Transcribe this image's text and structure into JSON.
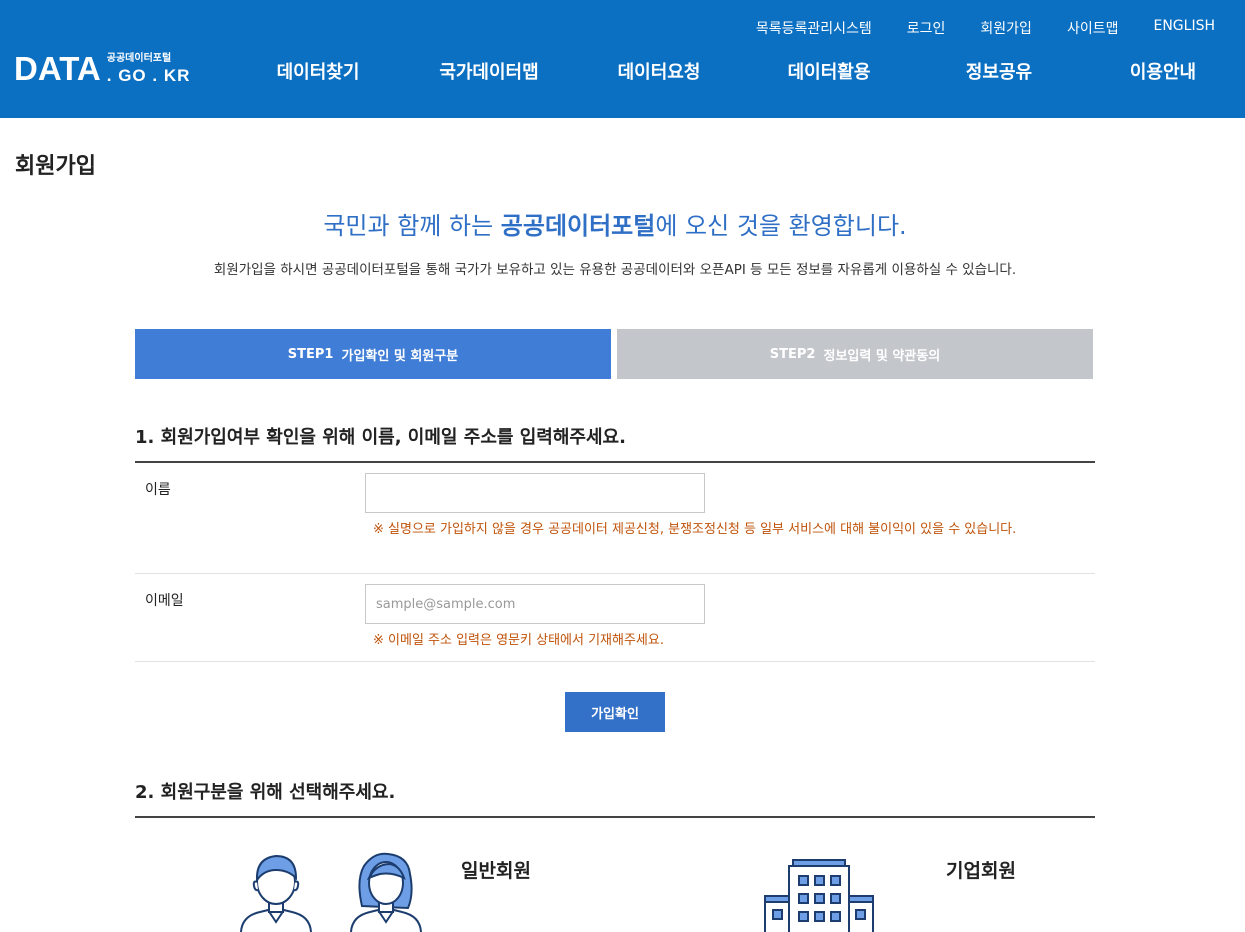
{
  "header": {
    "util_links": [
      "목록등록관리시스템",
      "로그인",
      "회원가입",
      "사이트맵",
      "ENGLISH"
    ],
    "logo": {
      "main": "DATA",
      "sub": "공공데이터포털",
      "domain": ". GO . KR"
    },
    "nav": [
      "데이터찾기",
      "국가데이터맵",
      "데이터요청",
      "데이터활용",
      "정보공유",
      "이용안내"
    ],
    "bg_color": "#0b6fc2"
  },
  "page_title": "회원가입",
  "welcome": {
    "prefix": "국민과 함께 하는 ",
    "highlight": "공공데이터포털",
    "suffix": "에 오신 것을 환영합니다.",
    "description": "회원가입을 하시면 공공데이터포털을 통해 국가가 보유하고 있는 유용한 공공데이터와 오픈API 등 모든 정보를 자유롭게 이용하실 수 있습니다."
  },
  "steps": [
    {
      "num": "STEP1",
      "label": "가입확인 및 회원구분",
      "active": true
    },
    {
      "num": "STEP2",
      "label": "정보입력 및 약관동의",
      "active": false
    }
  ],
  "section1": {
    "title": "1. 회원가입여부 확인을 위해 이름, 이메일 주소를 입력해주세요.",
    "name_label": "이름",
    "name_value": "",
    "name_note": "※ 실명으로 가입하지 않을 경우 공공데이터 제공신청, 분쟁조정신청 등 일부 서비스에 대해 불이익이 있을 수 있습니다.",
    "email_label": "이메일",
    "email_value": "",
    "email_placeholder": "sample@sample.com",
    "email_note": "※ 이메일 주소 입력은 영문키 상태에서 기재해주세요.",
    "confirm_button": "가입확인"
  },
  "section2": {
    "title": "2. 회원구분을 위해 선택해주세요.",
    "general_member": "일반회원",
    "corporate_member": "기업회원"
  },
  "colors": {
    "accent": "#3f7dd6",
    "note": "#c0530a",
    "inactive_step": "#c3c6cb"
  }
}
